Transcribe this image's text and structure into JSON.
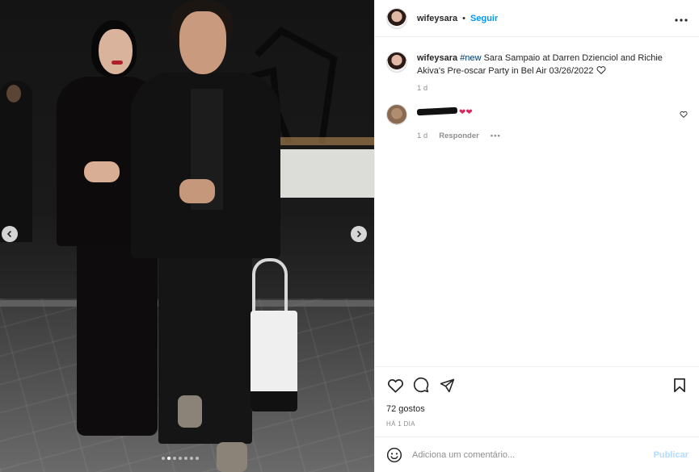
{
  "post": {
    "image_alt": "Sara Sampaio and companion walking at night",
    "carousel": {
      "dot_count": 7,
      "active_index": 1
    }
  },
  "header": {
    "username": "wifeysara",
    "separator": "•",
    "follow_label": "Seguir",
    "more_icon": "more-horizontal-icon"
  },
  "caption": {
    "username": "wifeysara",
    "hashtag": "#new",
    "text": " Sara Sampaio at Darren Dzienciol and Richie Akiva's Pre-oscar Party in Bel Air 03/26/2022 ",
    "age": "1 d"
  },
  "comment": {
    "emoji": "❤❤",
    "age": "1 d",
    "reply_label": "Responder",
    "more_label": "•••"
  },
  "actions": {
    "likes": "72 gostos",
    "time_ago": "HÁ 1 DIA"
  },
  "composer": {
    "placeholder": "Adiciona um comentário...",
    "publish_label": "Publicar"
  },
  "colors": {
    "link_blue": "#0095f6",
    "publish_disabled": "#b3dbff",
    "muted": "#8e8e8e",
    "text": "#262626"
  }
}
